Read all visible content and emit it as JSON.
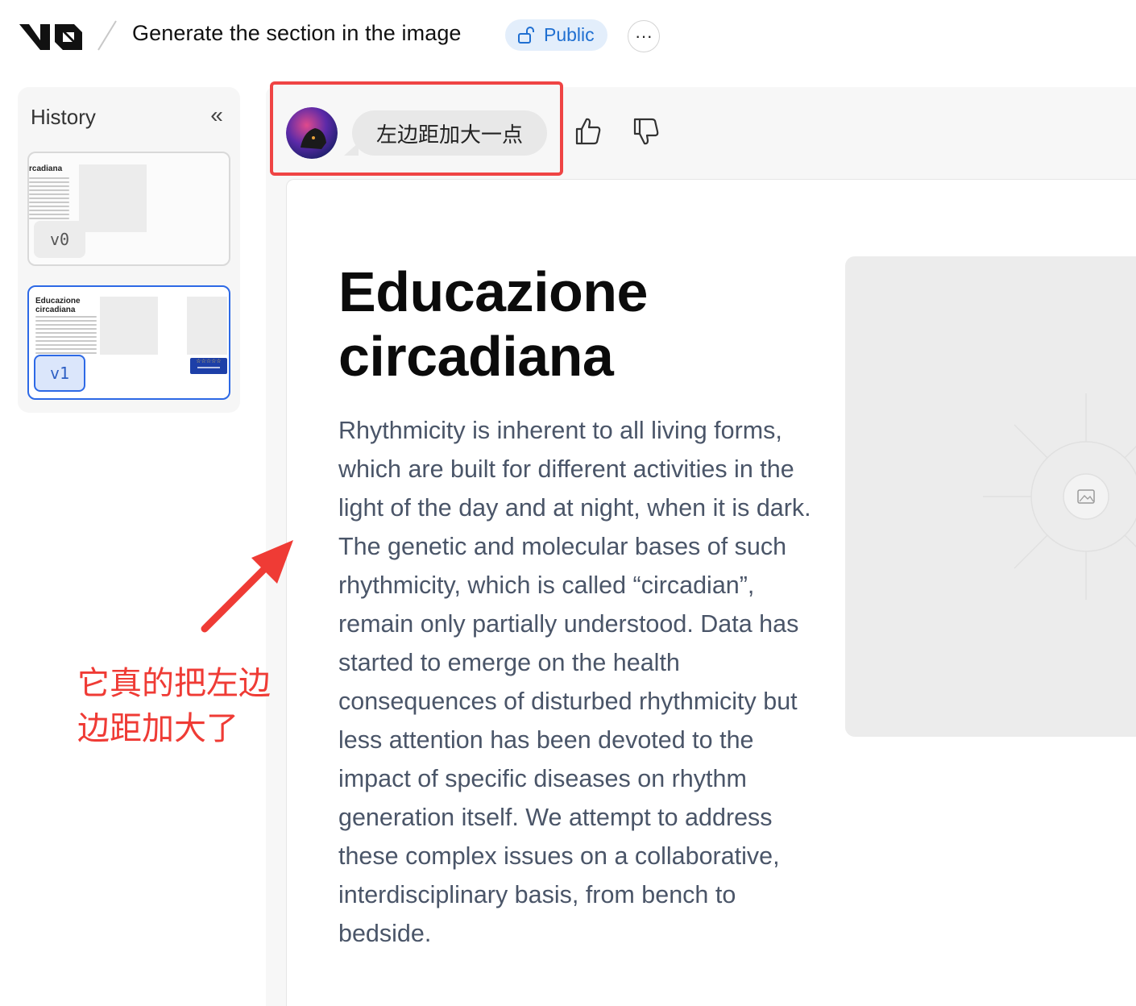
{
  "header": {
    "logo_label": "v0",
    "title": "Generate the section in the image",
    "visibility_label": "Public",
    "more_label": "···"
  },
  "history": {
    "title": "History",
    "versions": [
      {
        "label": "v0",
        "preview_title": "rcadiana"
      },
      {
        "label": "v1",
        "preview_title": "Educazione circadiana"
      }
    ]
  },
  "chat": {
    "user_message": "左边距加大一点",
    "feedback": [
      "thumbs-up-icon",
      "thumbs-down-icon"
    ]
  },
  "preview": {
    "heading": "Educazione circadiana",
    "body": "Rhythmicity is inherent to all living forms, which are built for different activities in the light of the day and at night, when it is dark. The genetic and molecular bases of such rhythmicity, which is called “circadian”, remain only partially understood. Data has started to emerge on the health consequences of disturbed rhythmicity but less attention has been devoted to the impact of specific diseases on rhythm generation itself. We attempt to address these complex issues on a collaborative, interdisciplinary basis, from bench to bedside."
  },
  "annotation": {
    "text": "它真的把左边边距加大了",
    "color": "#ef3b35"
  },
  "colors": {
    "accent": "#2d69e6",
    "highlight_box": "#ef4444",
    "badge_bg": "#e3eefb",
    "badge_text": "#1f6fd1"
  }
}
